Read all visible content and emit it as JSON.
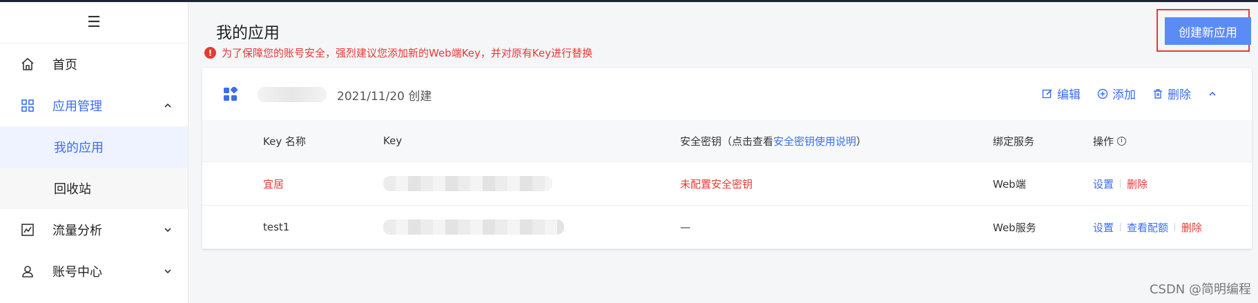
{
  "sidebar": {
    "hamburger": "☰",
    "items": [
      {
        "label": "首页",
        "icon": "home-icon"
      },
      {
        "label": "应用管理",
        "icon": "grid-icon",
        "expanded": true,
        "children": [
          {
            "label": "我的应用",
            "selected": true
          },
          {
            "label": "回收站"
          }
        ]
      },
      {
        "label": "流量分析",
        "icon": "chart-icon"
      },
      {
        "label": "账号中心",
        "icon": "user-icon"
      }
    ]
  },
  "header": {
    "title": "我的应用",
    "warning": "为了保障您的账号安全，强烈建议您添加新的Web端Key，并对原有Key进行替换",
    "create_button": "创建新应用"
  },
  "app": {
    "date_created": "2021/11/20 创建",
    "actions": {
      "edit": "编辑",
      "add": "添加",
      "delete": "删除"
    },
    "table": {
      "headers": {
        "key_name": "Key 名称",
        "key": "Key",
        "secret_prefix": "安全密钥（点击查看",
        "secret_link": "安全密钥使用说明",
        "secret_suffix": "）",
        "service": "绑定服务",
        "ops": "操作"
      },
      "rows": [
        {
          "name": "宜居",
          "secret": "未配置安全密钥",
          "service": "Web端",
          "ops": [
            "设置",
            "删除"
          ]
        },
        {
          "name": "test1",
          "secret": "—",
          "service": "Web服务",
          "ops": [
            "设置",
            "查看配额",
            "删除"
          ]
        }
      ]
    }
  },
  "watermark": "CSDN @简明编程",
  "colors": {
    "accent": "#3a6df0",
    "danger": "#e53935",
    "button": "#5b8cf5"
  }
}
